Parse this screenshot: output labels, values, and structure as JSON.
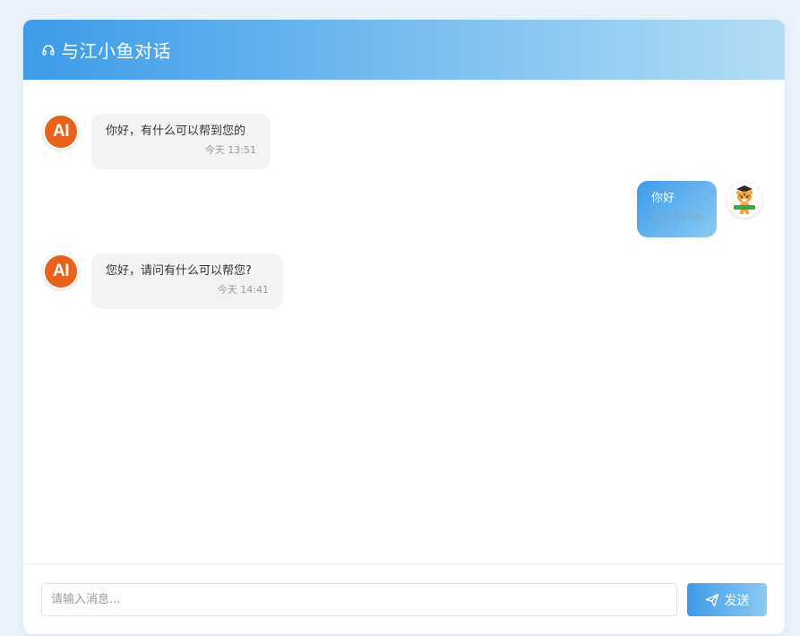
{
  "header": {
    "title": "与江小鱼对话",
    "icon": "headset-icon"
  },
  "colors": {
    "accent": "#3d9be9",
    "ai_avatar": "#e8621a",
    "ai_bubble": "#f3f3f3"
  },
  "messages": [
    {
      "role": "ai",
      "avatar_label": "AI",
      "text": "你好，有什么可以帮到您的",
      "time": "今天 13:51"
    },
    {
      "role": "user",
      "avatar": "tiger-mascot-icon",
      "text": "你好",
      "time": "今天 14:40"
    },
    {
      "role": "ai",
      "avatar_label": "AI",
      "text": "您好，请问有什么可以帮您?",
      "time": "今天 14:41"
    }
  ],
  "input": {
    "placeholder": "请输入消息...",
    "value": ""
  },
  "send_button": {
    "label": "发送",
    "icon": "paper-plane-icon"
  }
}
